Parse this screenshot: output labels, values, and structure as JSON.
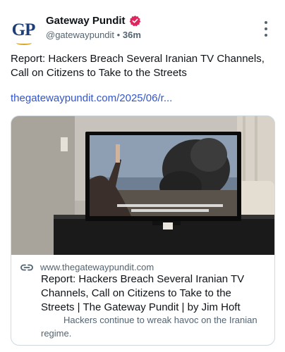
{
  "post": {
    "author": {
      "avatar_text": "GP",
      "display_name": "Gateway Pundit",
      "handle": "@gatewaypundit",
      "separator": "•",
      "time": "36m"
    },
    "text": "Report: Hackers Breach Several Iranian TV Channels, Call on Citizens to Take to the Streets",
    "link_text": "thegatewaypundit.com/2025/06/r...",
    "card": {
      "domain": "www.thegatewaypundit.com",
      "title": "Report: Hackers Breach Several Iranian TV Channels, Call on Citizens to Take to the Streets | The Gateway Pundit | by Jim Hoft",
      "description": "Hackers continue to wreak havoc on the Iranian regime."
    }
  },
  "icons": {
    "verified": "verified-badge-icon",
    "more": "more-options-icon",
    "link": "link-icon"
  },
  "colors": {
    "link": "#3355cc",
    "verified": "#e0245e",
    "avatar_text": "#1f3e75",
    "secondary_text": "#536471"
  }
}
